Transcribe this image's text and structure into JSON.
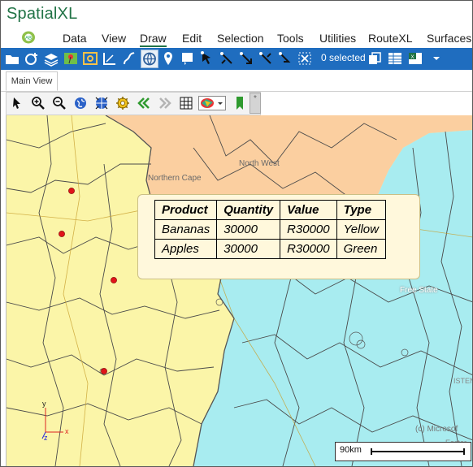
{
  "window": {
    "title": "SpatialXL"
  },
  "menu": {
    "items": [
      {
        "label": "Data"
      },
      {
        "label": "View"
      },
      {
        "label": "Draw",
        "active": true
      },
      {
        "label": "Edit"
      },
      {
        "label": "Selection"
      },
      {
        "label": "Tools"
      },
      {
        "label": "Utilities"
      },
      {
        "label": "RouteXL"
      },
      {
        "label": "Surfaces"
      }
    ]
  },
  "ribbon": {
    "icons": [
      "open-folder-icon",
      "add-layer-icon",
      "layers-icon",
      "map-pin-icon",
      "label-icon",
      "measure-icon",
      "route-icon",
      "globe-icon",
      "marker-icon",
      "select-frame-icon",
      "pointer-icon",
      "edit-vertex-icon",
      "move-vertex-icon",
      "delete-vertex-icon",
      "rotate-icon",
      "clear-selection-icon"
    ],
    "selection_status": "0 selected",
    "right_icons": [
      "copy-icon",
      "table-icon",
      "excel-icon",
      "dropdown-icon"
    ]
  },
  "tabs": [
    {
      "label": "Main View"
    }
  ],
  "map_toolbar": {
    "tools": [
      "pointer-tool",
      "zoom-in-tool",
      "zoom-out-tool",
      "globe-tool",
      "full-extent-tool",
      "settings-tool",
      "back-tool",
      "forward-tool",
      "grid-tool",
      "basemap-picker",
      "bookmark-tool"
    ]
  },
  "map": {
    "labels": {
      "northern_cape": "Northern Cape",
      "north_west": "North West",
      "free_state": "Free State",
      "eastern": "Easter",
      "eastern_top": "ISTEN",
      "attribution": "(c) Microsof"
    },
    "axes": {
      "x": "x",
      "y": "y",
      "z": "z"
    },
    "colors": {
      "northern_cape": "#fbf5a8",
      "north_west": "#fbcfa0",
      "free_state": "#a8ecf0",
      "point": "#e0141a"
    },
    "scale_label": "90km"
  },
  "popup": {
    "headers": [
      "Product",
      "Quantity",
      "Value",
      "Type"
    ],
    "rows": [
      [
        "Bananas",
        "30000",
        "R30000",
        "Yellow"
      ],
      [
        "Apples",
        "30000",
        "R30000",
        "Green"
      ]
    ]
  }
}
